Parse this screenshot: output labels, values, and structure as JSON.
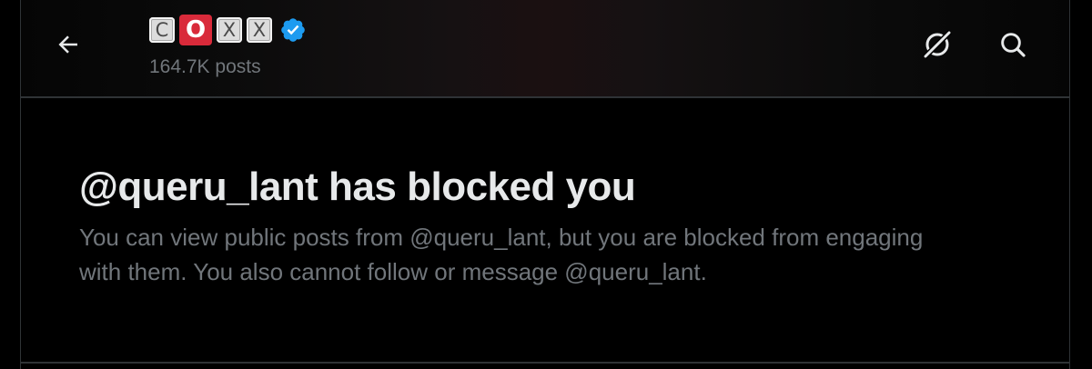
{
  "header": {
    "back_icon": "arrow-left-icon",
    "name_letters": [
      "C",
      "O",
      "X",
      "X"
    ],
    "name_highlight_color": "#d92a3a",
    "verified_icon": "verified-badge-icon",
    "verified_color": "#1d9bf0",
    "post_count": "164.7K posts",
    "grok_icon": "grok-icon",
    "search_icon": "search-icon"
  },
  "blocked": {
    "title": "@queru_lant has blocked you",
    "description": "You can view public posts from @queru_lant, but you are blocked from engaging with them. You also cannot follow or message @queru_lant."
  },
  "colors": {
    "background": "#000000",
    "primary_text": "#e7e9ea",
    "secondary_text": "#71767b",
    "border": "#2f3336"
  }
}
